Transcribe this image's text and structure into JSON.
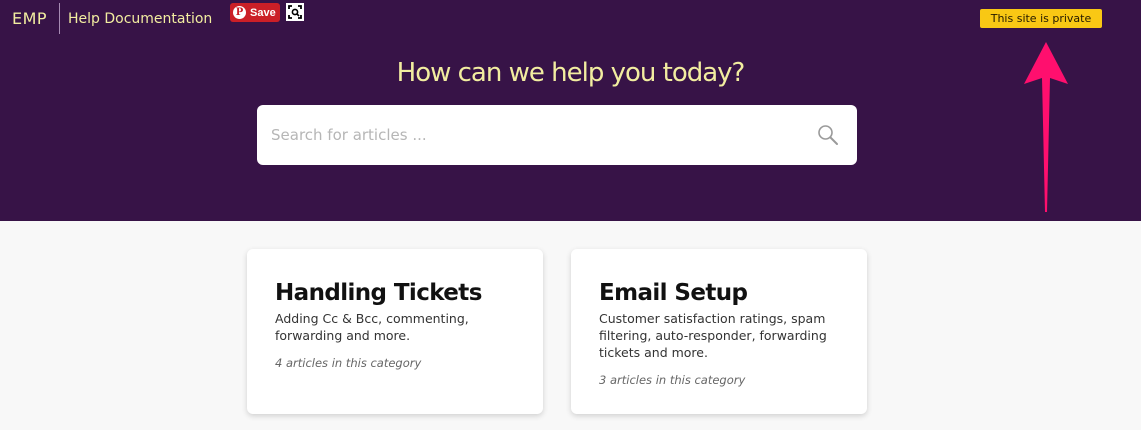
{
  "header": {
    "brand": "EMP",
    "site_title": "Help Documentation",
    "pinterest_save_label": "Save",
    "pinterest_logo": "P",
    "private_badge": "This site is private"
  },
  "hero": {
    "heading": "How can we help you today?",
    "search_placeholder": "Search for articles ..."
  },
  "categories": [
    {
      "title": "Handling Tickets",
      "description": "Adding Cc & Bcc, commenting, forwarding and more.",
      "count": "4 articles in this category"
    },
    {
      "title": "Email Setup",
      "description": "Customer satisfaction ratings, spam filtering, auto-responder, forwarding tickets and more.",
      "count": "3 articles in this category"
    }
  ],
  "colors": {
    "hero_bg": "#371347",
    "accent_text": "#f2eda0",
    "badge_bg": "#f9c814",
    "pinterest_red": "#cb1f27",
    "annotation_arrow": "#ff0f6e"
  },
  "icons": {
    "search": "search-icon",
    "pinterest": "pinterest-icon",
    "lens": "lens-scan-icon",
    "arrow": "up-arrow-annotation-icon"
  }
}
